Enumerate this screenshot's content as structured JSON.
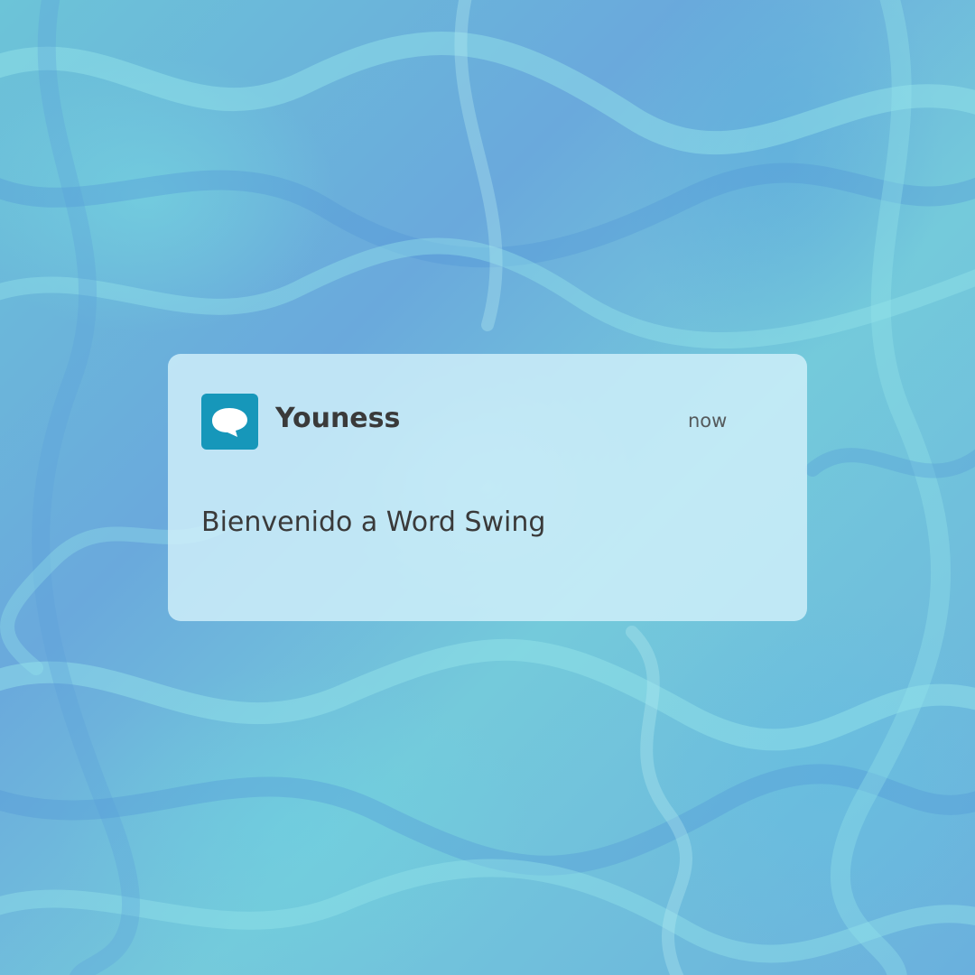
{
  "notification": {
    "app_icon": "chat-bubble-icon",
    "sender": "Youness",
    "time": "now",
    "message": "Bienvenido a Word Swing"
  },
  "colors": {
    "icon_background": "#1697ba",
    "card_background": "#d2f0fa",
    "text": "#3a3a3a"
  }
}
